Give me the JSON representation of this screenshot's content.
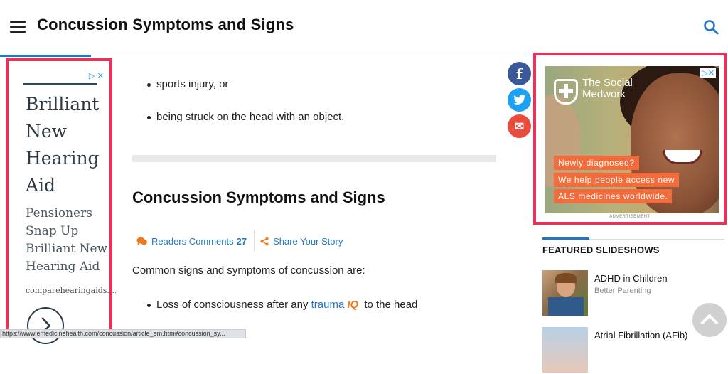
{
  "header": {
    "title": "Concussion Symptoms and Signs"
  },
  "left_ad": {
    "adchoices": "▷ ✕",
    "headline": "Brilliant New Hearing Aid",
    "subtext": "Pensioners Snap Up Brilliant New Hearing Aid",
    "domain": "comparehearingaids...."
  },
  "content": {
    "bullets_top": [
      "sports injury, or",
      "being struck on the head with an object."
    ],
    "section_heading": "Concussion Symptoms and Signs",
    "readers_comments_label": "Readers Comments",
    "readers_comments_count": "27",
    "share_story_label": "Share Your Story",
    "intro": "Common signs and symptoms of concussion are:",
    "bullet_loss_prefix": "Loss of consciousness after any",
    "bullet_loss_link": "trauma",
    "bullet_loss_iq": "IQ",
    "bullet_loss_suffix": "to the head"
  },
  "share": {
    "facebook": "f",
    "email": "✉",
    "colors": {
      "facebook": "#3b5998",
      "twitter": "#1da1f2",
      "email": "#e74c3c"
    }
  },
  "right_ad": {
    "brand": "The Social Medwork",
    "line1": "Newly diagnosed?",
    "line2": "We help people access new",
    "line3": "ALS medicines worldwide.",
    "adchoices": "▷✕",
    "label": "ADVERTISEMENT"
  },
  "slideshows": {
    "heading": "FEATURED SLIDESHOWS",
    "items": [
      {
        "title": "ADHD in Children",
        "subtitle": "Better Parenting"
      },
      {
        "title": "Atrial Fibrillation (AFib)",
        "subtitle": ""
      }
    ]
  },
  "status_bar": {
    "url": "https://www.emedicinehealth.com/concussion/article_em.htm#concussion_sy..."
  },
  "colors": {
    "accent": "#1f78c8",
    "ad_border": "#e8315b",
    "banner": "#f26b3a"
  }
}
